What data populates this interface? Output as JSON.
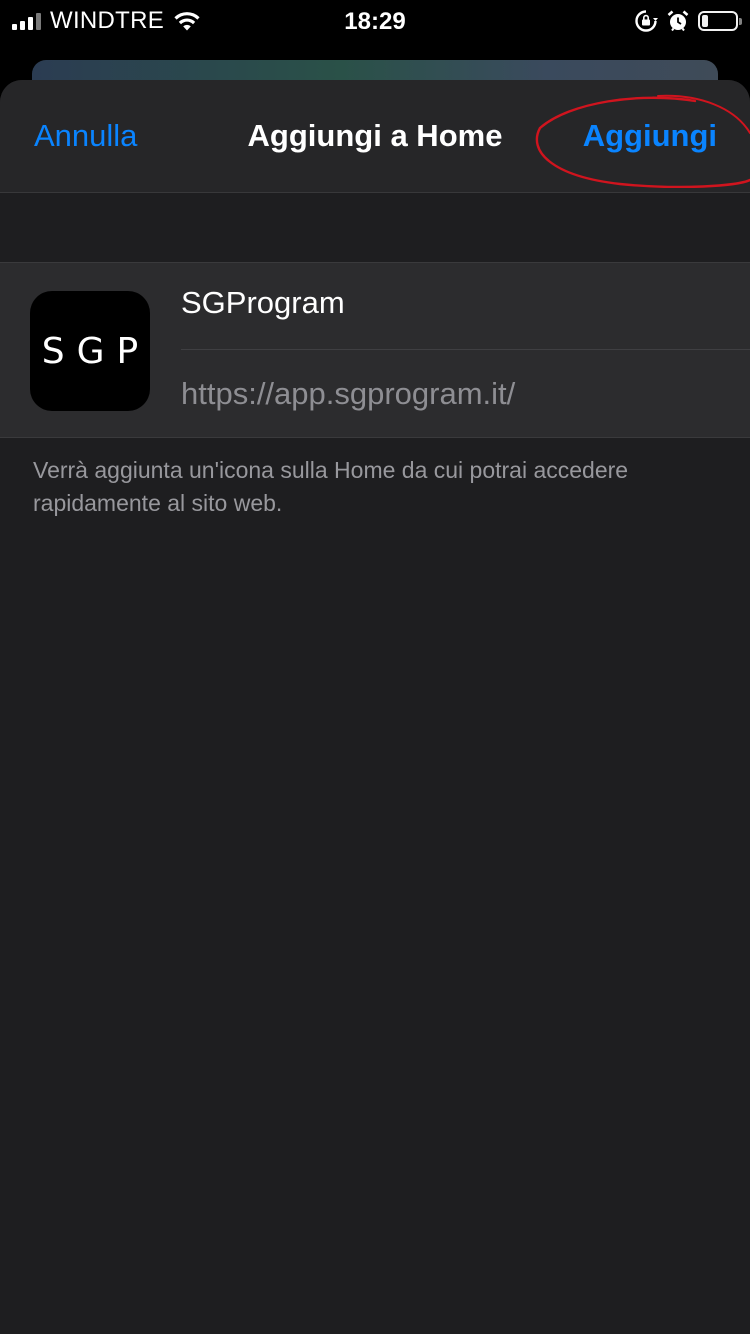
{
  "status_bar": {
    "carrier": "WINDTRE",
    "time": "18:29",
    "battery_level": 0.2,
    "icons": [
      "signal-icon",
      "wifi-icon",
      "rotation-lock-icon",
      "alarm-icon",
      "battery-icon"
    ]
  },
  "nav": {
    "cancel_label": "Annulla",
    "title": "Aggiungi a Home",
    "add_label": "Aggiungi"
  },
  "app": {
    "icon_text": "SGP",
    "name": "SGProgram",
    "url": "https://app.sgprogram.it/"
  },
  "helper": {
    "text": "Verrà aggiunta un'icona sulla Home da cui potrai accedere rapidamente al sito web."
  },
  "colors": {
    "accent": "#0a84ff",
    "sheet_background": "#1e1e20",
    "group_background": "#2c2c2e",
    "annotation": "#d0141e"
  }
}
